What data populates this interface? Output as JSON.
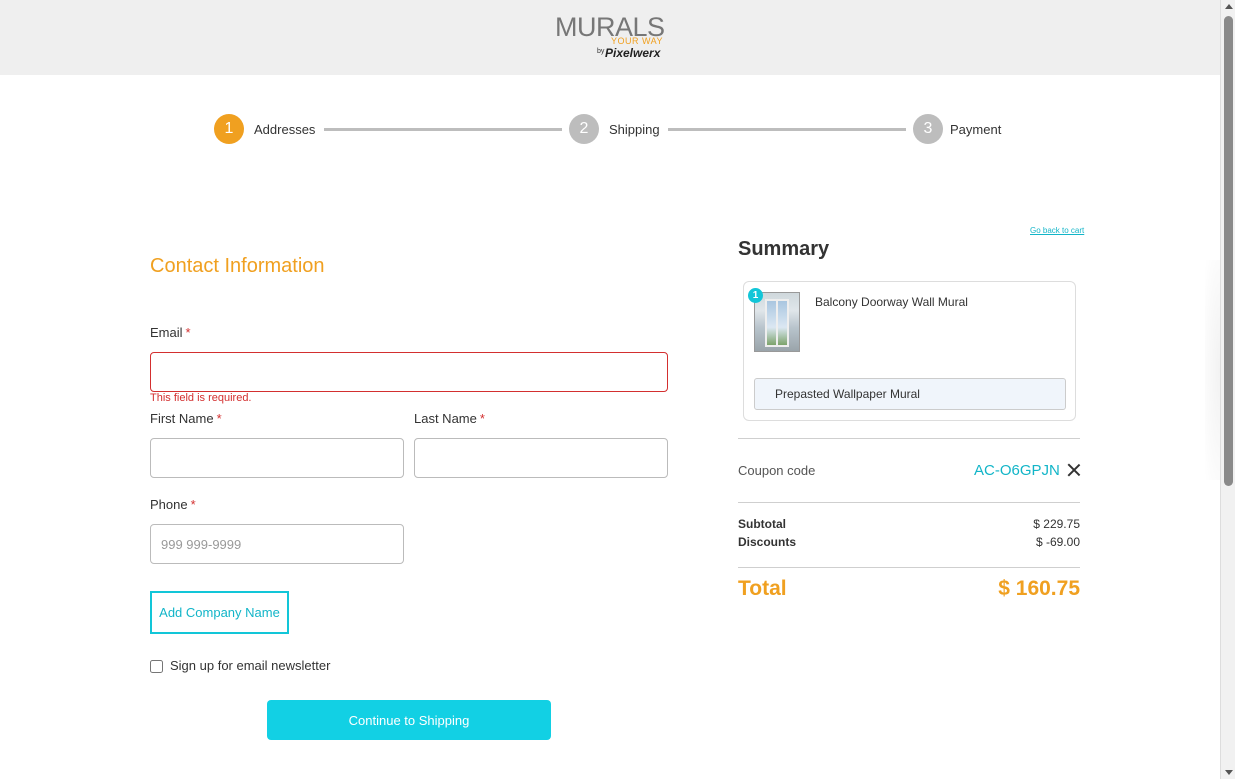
{
  "brand": {
    "logo_main": "MURALS",
    "logo_tagline": "YOUR WAY",
    "logo_by": "by",
    "logo_company": "Pixelwerx",
    "colors": {
      "accent": "#f0a020",
      "primary": "#12d0e4",
      "error": "#d32f2f"
    }
  },
  "steps": [
    {
      "number": "1",
      "label": "Addresses",
      "active": true
    },
    {
      "number": "2",
      "label": "Shipping",
      "active": false
    },
    {
      "number": "3",
      "label": "Payment",
      "active": false
    }
  ],
  "contact": {
    "title": "Contact Information",
    "email_label": "Email",
    "email_value": "",
    "email_error": "This field is required.",
    "first_name_label": "First Name",
    "first_name_value": "",
    "last_name_label": "Last Name",
    "last_name_value": "",
    "phone_label": "Phone",
    "phone_placeholder": "999 999-9999",
    "required_mark": "*",
    "add_company_label": "Add Company Name",
    "newsletter_label": "Sign up for email newsletter",
    "newsletter_checked": false,
    "continue_label": "Continue to Shipping"
  },
  "summary": {
    "back_link": "Go back to cart",
    "title": "Summary",
    "item": {
      "quantity": "1",
      "name": "Balcony Doorway Wall Mural",
      "variant": "Prepasted Wallpaper Mural"
    },
    "coupon_label": "Coupon code",
    "coupon_code": "AC-O6GPJN",
    "subtotal_label": "Subtotal",
    "subtotal_value": "$ 229.75",
    "discounts_label": "Discounts",
    "discounts_value": "$ -69.00",
    "total_label": "Total",
    "total_value": "$ 160.75"
  }
}
